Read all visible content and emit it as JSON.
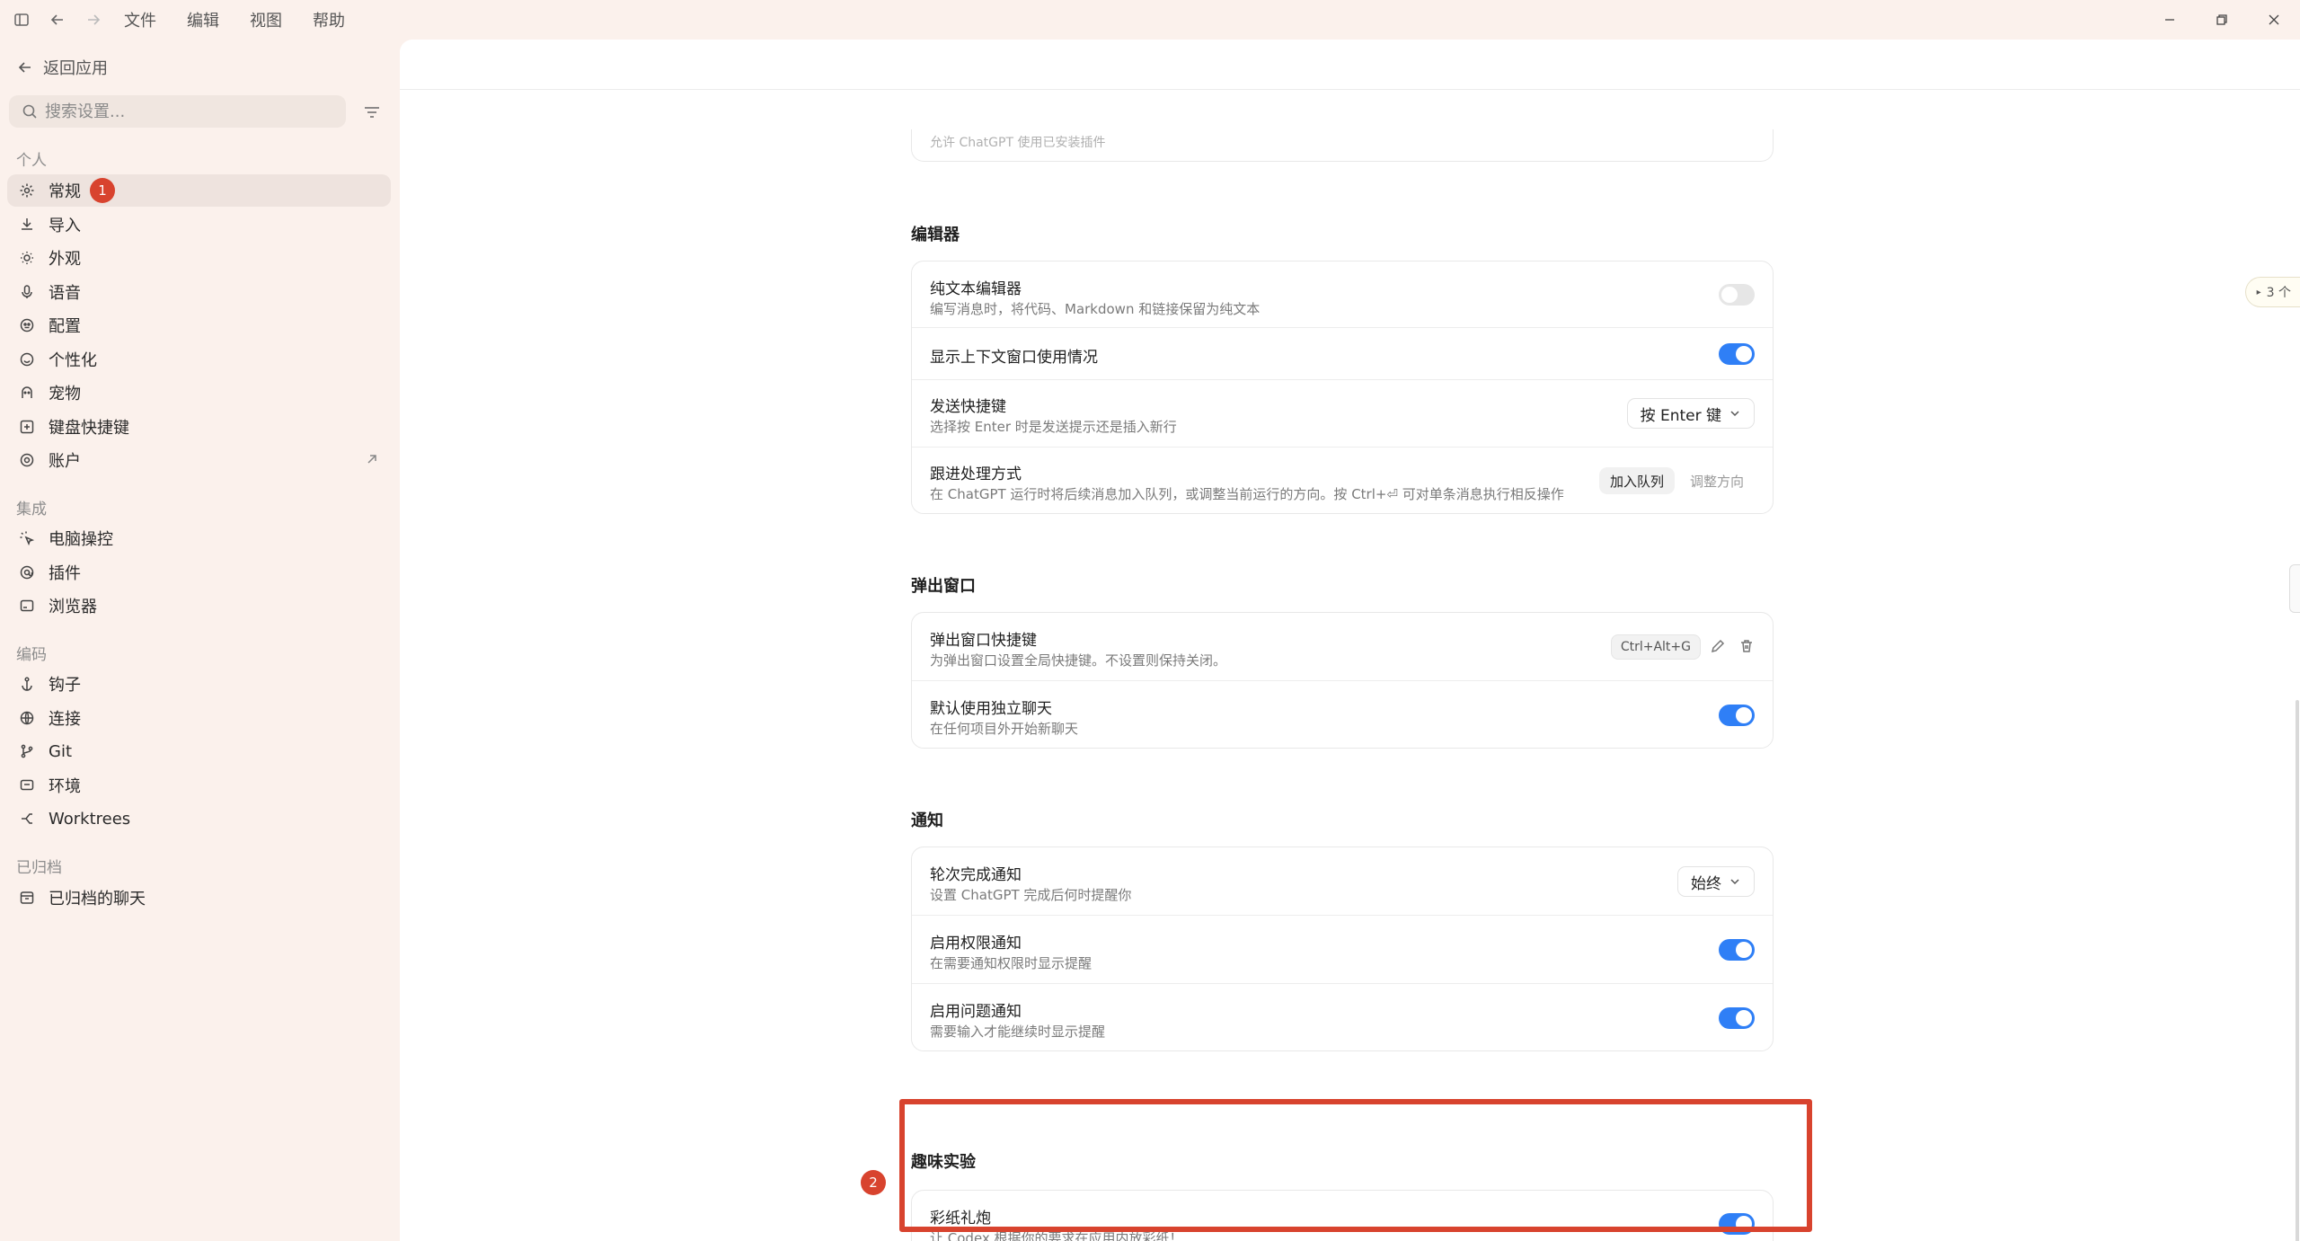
{
  "menu": {
    "file": "文件",
    "edit": "编辑",
    "view": "视图",
    "help": "帮助"
  },
  "sidebar": {
    "back": "返回应用",
    "search_placeholder": "搜索设置...",
    "groups": [
      {
        "title": "个人"
      },
      {
        "title": "集成"
      },
      {
        "title": "编码"
      },
      {
        "title": "已归档"
      }
    ],
    "items": {
      "general": "常规",
      "import": "导入",
      "appearance": "外观",
      "voice": "语音",
      "config": "配置",
      "personalization": "个性化",
      "pets": "宠物",
      "shortcuts": "键盘快捷键",
      "account": "账户",
      "computer_control": "电脑操控",
      "plugins": "插件",
      "browser": "浏览器",
      "hooks": "钩子",
      "connections": "连接",
      "git": "Git",
      "environment": "环境",
      "worktrees": "Worktrees",
      "archived_chats": "已归档的聊天"
    },
    "badge_general": "1"
  },
  "main": {
    "cut_text": "允许 ChatGPT 使用已安装插件",
    "side_tag": "3 个",
    "editor": {
      "title": "编辑器",
      "plain_text": {
        "title": "纯文本编辑器",
        "desc": "编写消息时，将代码、Markdown 和链接保留为纯文本",
        "on": false
      },
      "context_usage": {
        "title": "显示上下文窗口使用情况",
        "on": true
      },
      "send_shortcut": {
        "title": "发送快捷键",
        "desc": "选择按 Enter 时是发送提示还是插入新行",
        "value": "按 Enter 键"
      },
      "follow_up": {
        "title": "跟进处理方式",
        "desc": "在 ChatGPT 运行时将后续消息加入队列，或调整当前运行的方向。按 Ctrl+⏎ 可对单条消息执行相反操作",
        "opt1": "加入队列",
        "opt2": "调整方向"
      }
    },
    "popup": {
      "title": "弹出窗口",
      "shortcut": {
        "title": "弹出窗口快捷键",
        "desc": "为弹出窗口设置全局快捷键。不设置则保持关闭。",
        "keys": "Ctrl+Alt+G"
      },
      "standalone": {
        "title": "默认使用独立聊天",
        "desc": "在任何项目外开始新聊天",
        "on": true
      }
    },
    "notifications": {
      "title": "通知",
      "turn_complete": {
        "title": "轮次完成通知",
        "desc": "设置 ChatGPT 完成后何时提醒你",
        "value": "始终"
      },
      "permission": {
        "title": "启用权限通知",
        "desc": "在需要通知权限时显示提醒",
        "on": true
      },
      "question": {
        "title": "启用问题通知",
        "desc": "需要输入才能继续时显示提醒",
        "on": true
      }
    },
    "fun": {
      "title": "趣味实验",
      "confetti": {
        "title": "彩纸礼炮",
        "desc": "让 Codex 根据你的要求在应用内放彩纸！",
        "on": true
      }
    },
    "badge_fun": "2"
  },
  "colors": {
    "accent": "#2f7ff6",
    "highlight": "#d8432e",
    "sidebar_bg": "#fbf1ec"
  }
}
